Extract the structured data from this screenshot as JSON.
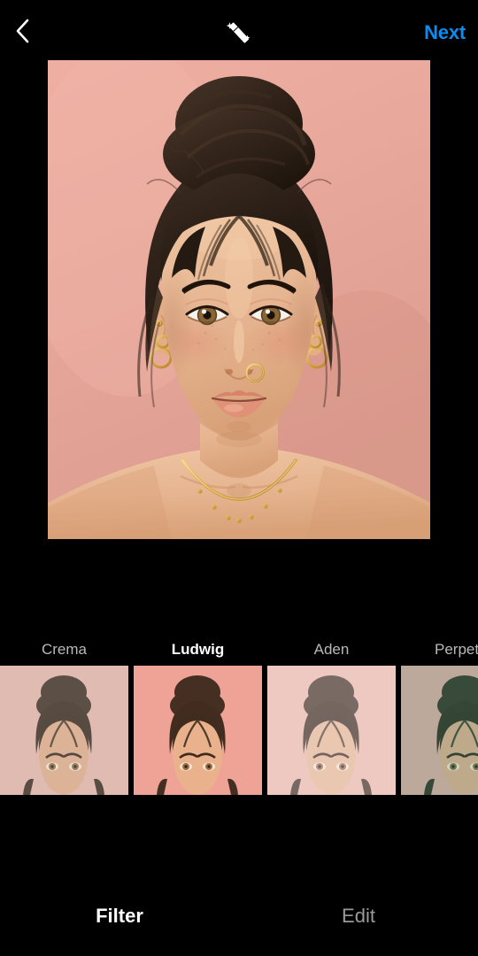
{
  "app": {
    "screen_title": "Filter",
    "background_color": "#000000",
    "accent_color": "#0a8cf0"
  },
  "topbar": {
    "back_icon": "chevron-left-icon",
    "magic_icon": "magic-wand-icon",
    "next_label": "Next"
  },
  "photo": {
    "alt": "Portrait of a young woman with dark hair in a top bun against a pink background",
    "background_color": "#e8a79b",
    "skin_color": "#e8b694",
    "hair_color": "#2e2119",
    "jewelry_color": "#d9a441"
  },
  "filters": {
    "selected": "Ludwig",
    "items": [
      {
        "name": "Crema",
        "selected": false,
        "tint": "rgba(205,185,175,0.30)"
      },
      {
        "name": "Ludwig",
        "selected": true,
        "tint": "rgba(240,140,130,0.16)"
      },
      {
        "name": "Aden",
        "selected": false,
        "tint": "rgba(236,210,205,0.38)"
      },
      {
        "name": "Perpetua",
        "selected": false,
        "tint": "rgba(120,150,120,0.30)"
      }
    ]
  },
  "bottom_tabs": [
    {
      "label": "Filter",
      "active": true
    },
    {
      "label": "Edit",
      "active": false
    }
  ]
}
